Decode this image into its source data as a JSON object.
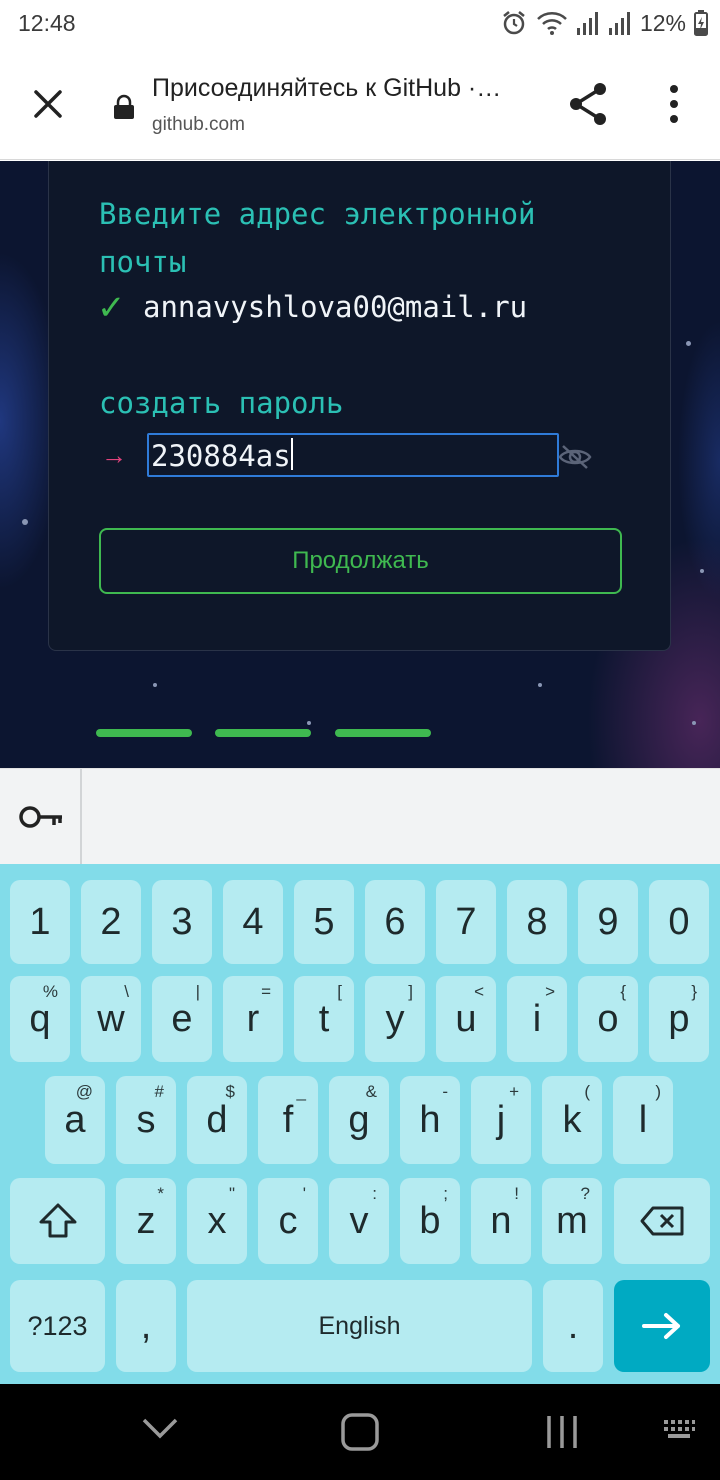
{
  "status": {
    "time": "12:48",
    "battery": "12%"
  },
  "browser": {
    "title": "Присоединяйтесь к GitHub ·…",
    "url": "github.com"
  },
  "signup": {
    "email_heading": "Введите адрес электронной почты",
    "email_check": "✓",
    "email_value": "annavyshlova00@mail.ru",
    "password_heading": "создать пароль",
    "password_arrow": "→",
    "password_value": "230884as",
    "continue_label": "Продолжать",
    "progress_steps_completed": 3,
    "progress_steps_total": 3
  },
  "keyboard": {
    "rows": [
      [
        {
          "k": "1"
        },
        {
          "k": "2"
        },
        {
          "k": "3"
        },
        {
          "k": "4"
        },
        {
          "k": "5"
        },
        {
          "k": "6"
        },
        {
          "k": "7"
        },
        {
          "k": "8"
        },
        {
          "k": "9"
        },
        {
          "k": "0"
        }
      ],
      [
        {
          "k": "q",
          "h": "%"
        },
        {
          "k": "w",
          "h": "\\"
        },
        {
          "k": "e",
          "h": "|"
        },
        {
          "k": "r",
          "h": "="
        },
        {
          "k": "t",
          "h": "["
        },
        {
          "k": "y",
          "h": "]"
        },
        {
          "k": "u",
          "h": "<"
        },
        {
          "k": "i",
          "h": ">"
        },
        {
          "k": "o",
          "h": "{"
        },
        {
          "k": "p",
          "h": "}"
        }
      ],
      [
        {
          "k": "a",
          "h": "@"
        },
        {
          "k": "s",
          "h": "#"
        },
        {
          "k": "d",
          "h": "$"
        },
        {
          "k": "f",
          "h": "_"
        },
        {
          "k": "g",
          "h": "&"
        },
        {
          "k": "h",
          "h": "-"
        },
        {
          "k": "j",
          "h": "+"
        },
        {
          "k": "k",
          "h": "("
        },
        {
          "k": "l",
          "h": ")"
        }
      ],
      [
        {
          "k": "z",
          "h": "*"
        },
        {
          "k": "x",
          "h": "\""
        },
        {
          "k": "c",
          "h": "'"
        },
        {
          "k": "v",
          "h": ":"
        },
        {
          "k": "b",
          "h": ";"
        },
        {
          "k": "n",
          "h": "!"
        },
        {
          "k": "m",
          "h": "?"
        }
      ]
    ],
    "symbols_label": "?123",
    "comma_label": ",",
    "space_label": "English",
    "period_label": ".",
    "shift_icon": "shift-icon",
    "backspace_icon": "backspace-icon",
    "enter_icon": "arrow-right-icon"
  },
  "colors": {
    "accent_green": "#3fb950",
    "heading_teal": "#2bc0b4",
    "keyboard_bg": "#82dce9",
    "enter_key": "#00aac2"
  }
}
